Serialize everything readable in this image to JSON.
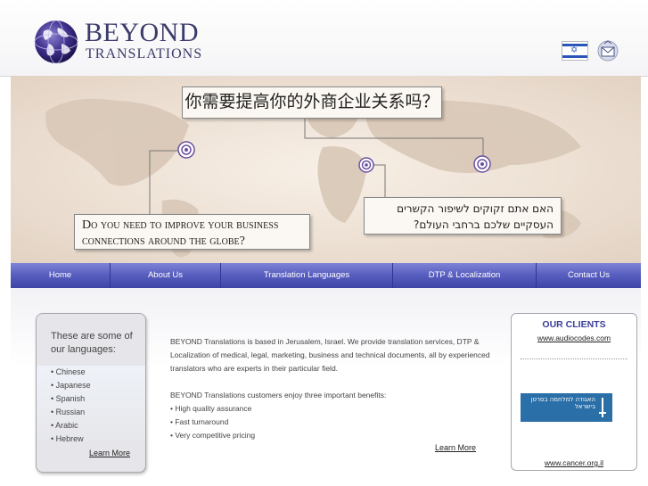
{
  "header": {
    "brand_line1": "BEYOND",
    "brand_line2": "TRANSLATIONS"
  },
  "hero": {
    "chinese_text": "你需要提高你的外商企业关系吗？",
    "english_text": "Do you need to improve your business connections around the globe?",
    "hebrew_text": "האם אתם זקוקים לשיפור הקשרים העסקיים שלכם ברחבי העולם?"
  },
  "nav": {
    "items": [
      "Home",
      "About Us",
      "Translation Languages",
      "DTP & Localization",
      "Contact Us"
    ]
  },
  "languages_panel": {
    "title": "These are some of our languages:",
    "items": [
      "• Chinese",
      "• Japanese",
      "• Spanish",
      "• Russian",
      "• Arabic",
      "• Hebrew"
    ],
    "learn_more": "Learn More"
  },
  "main": {
    "paragraph1": "BEYOND Translations is based in Jerusalem, Israel. We provide translation services, DTP & Localization of medical, legal, marketing, business and technical documents, all by experienced translators who are experts in their particular field.",
    "paragraph2": "BEYOND Translations customers enjoy three important benefits:",
    "benefits": [
      "• High quality assurance",
      "• Fast turnaround",
      "• Very competitive pricing"
    ],
    "learn_more": "Learn More"
  },
  "clients": {
    "title": "OUR CLIENTS",
    "link1": "www.audiocodes.com",
    "logo_text": "האגודה למלחמה בסרטן בישראל",
    "link2": "www.cancer.org.il"
  },
  "colors": {
    "nav_top": "#7d84d6",
    "nav_bottom": "#3e44a6",
    "brand": "#3b3b6b",
    "clients_title": "#3a3f98"
  },
  "icons": {
    "logo": "globe-logo-icon",
    "flag": "israel-flag-icon",
    "mail": "mail-envelope-icon",
    "markers": "target-marker-icon"
  }
}
